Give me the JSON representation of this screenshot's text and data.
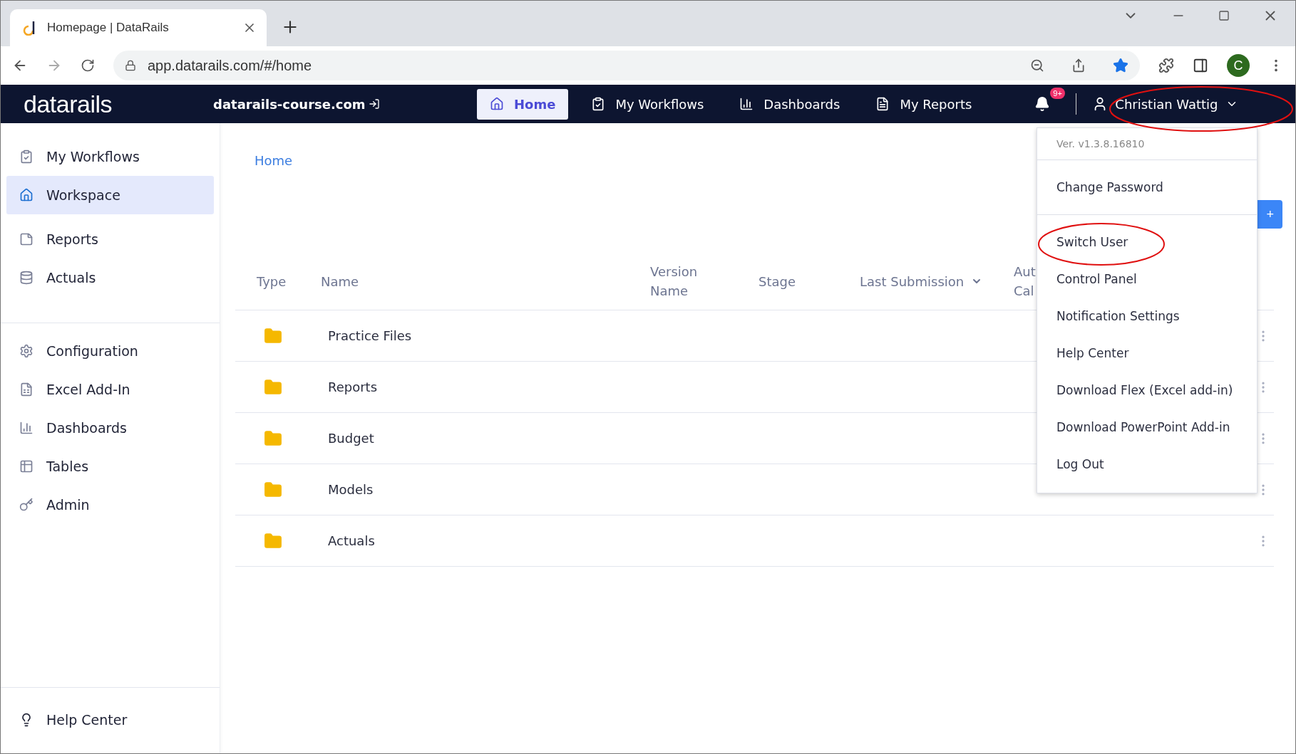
{
  "browser": {
    "tab_title": "Homepage | DataRails",
    "url": "app.datarails.com/#/home",
    "profile_initial": "C"
  },
  "navbar": {
    "logo": "datarails",
    "company": "datarails-course.com",
    "items": [
      {
        "label": "Home",
        "selected": true
      },
      {
        "label": "My Workflows",
        "selected": false
      },
      {
        "label": "Dashboards",
        "selected": false
      },
      {
        "label": "My Reports",
        "selected": false
      }
    ],
    "notification_badge": "9+",
    "user": "Christian Wattig"
  },
  "sidebar": {
    "top_items": [
      {
        "label": "My Workflows",
        "selected": false
      },
      {
        "label": "Workspace",
        "selected": true
      },
      {
        "label": "Reports",
        "selected": false
      },
      {
        "label": "Actuals",
        "selected": false
      }
    ],
    "main_items": [
      {
        "label": "Configuration",
        "selected": false
      },
      {
        "label": "Excel Add-In",
        "selected": false
      },
      {
        "label": "Dashboards",
        "selected": false
      },
      {
        "label": "Tables",
        "selected": false
      },
      {
        "label": "Admin",
        "selected": false
      }
    ],
    "footer_item": "Help Center"
  },
  "breadcrumb": "Home",
  "action_button": "+",
  "table": {
    "columns": [
      "Type",
      "Name",
      "Version Name",
      "Stage",
      "Last Submission",
      "Aut Cal"
    ],
    "rows": [
      {
        "name": "Practice Files"
      },
      {
        "name": "Reports"
      },
      {
        "name": "Budget"
      },
      {
        "name": "Models"
      },
      {
        "name": "Actuals"
      }
    ]
  },
  "user_menu": {
    "version": "Ver. v1.3.8.16810",
    "account_items": [
      "Change Password"
    ],
    "items": [
      "Switch User",
      "Control Panel",
      "Notification Settings",
      "Help Center",
      "Download Flex (Excel add-in)",
      "Download PowerPoint Add-in",
      "Log Out"
    ]
  }
}
